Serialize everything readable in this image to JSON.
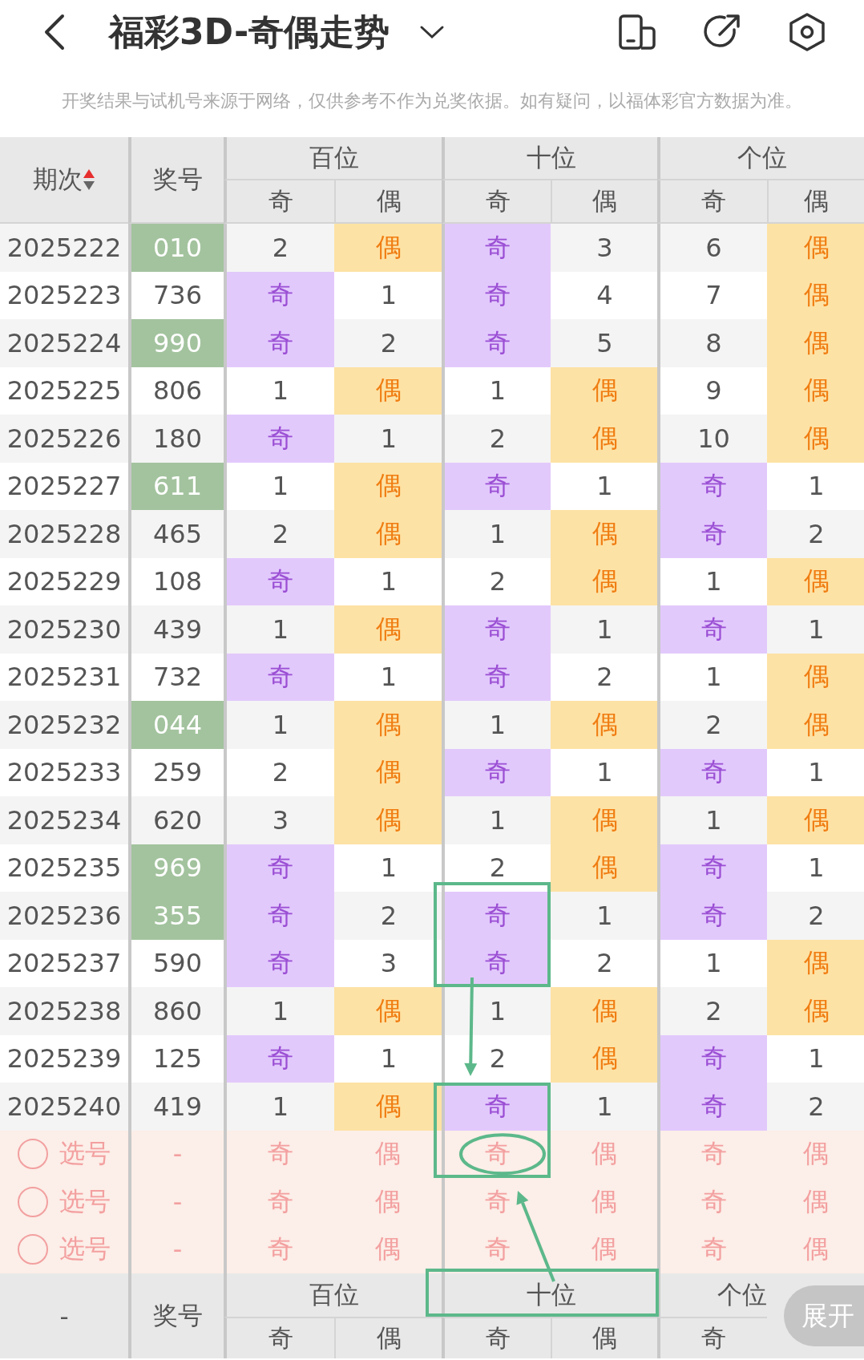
{
  "header": {
    "title": "福彩3D-奇偶走势"
  },
  "notice": "开奖结果与试机号来源于网络，仅供参考不作为兑奖依据。如有疑问，以福体彩官方数据为准。",
  "table": {
    "issue_label": "期次",
    "number_label": "奖号",
    "groups": [
      "百位",
      "十位",
      "个位"
    ],
    "sub_labels": [
      "奇",
      "偶",
      "奇",
      "偶",
      "奇",
      "偶"
    ],
    "rows": [
      {
        "issue": "2025222",
        "number": "010",
        "highlighted": true,
        "cells": [
          {
            "text": "2",
            "hit": false
          },
          {
            "text": "偶",
            "hit": true
          },
          {
            "text": "奇",
            "hit": true
          },
          {
            "text": "3",
            "hit": false
          },
          {
            "text": "6",
            "hit": false
          },
          {
            "text": "偶",
            "hit": true
          }
        ]
      },
      {
        "issue": "2025223",
        "number": "736",
        "highlighted": false,
        "cells": [
          {
            "text": "奇",
            "hit": true
          },
          {
            "text": "1",
            "hit": false
          },
          {
            "text": "奇",
            "hit": true
          },
          {
            "text": "4",
            "hit": false
          },
          {
            "text": "7",
            "hit": false
          },
          {
            "text": "偶",
            "hit": true
          }
        ]
      },
      {
        "issue": "2025224",
        "number": "990",
        "highlighted": true,
        "cells": [
          {
            "text": "奇",
            "hit": true
          },
          {
            "text": "2",
            "hit": false
          },
          {
            "text": "奇",
            "hit": true
          },
          {
            "text": "5",
            "hit": false
          },
          {
            "text": "8",
            "hit": false
          },
          {
            "text": "偶",
            "hit": true
          }
        ]
      },
      {
        "issue": "2025225",
        "number": "806",
        "highlighted": false,
        "cells": [
          {
            "text": "1",
            "hit": false
          },
          {
            "text": "偶",
            "hit": true
          },
          {
            "text": "1",
            "hit": false
          },
          {
            "text": "偶",
            "hit": true
          },
          {
            "text": "9",
            "hit": false
          },
          {
            "text": "偶",
            "hit": true
          }
        ]
      },
      {
        "issue": "2025226",
        "number": "180",
        "highlighted": false,
        "cells": [
          {
            "text": "奇",
            "hit": true
          },
          {
            "text": "1",
            "hit": false
          },
          {
            "text": "2",
            "hit": false
          },
          {
            "text": "偶",
            "hit": true
          },
          {
            "text": "10",
            "hit": false
          },
          {
            "text": "偶",
            "hit": true
          }
        ]
      },
      {
        "issue": "2025227",
        "number": "611",
        "highlighted": true,
        "cells": [
          {
            "text": "1",
            "hit": false
          },
          {
            "text": "偶",
            "hit": true
          },
          {
            "text": "奇",
            "hit": true
          },
          {
            "text": "1",
            "hit": false
          },
          {
            "text": "奇",
            "hit": true
          },
          {
            "text": "1",
            "hit": false
          }
        ]
      },
      {
        "issue": "2025228",
        "number": "465",
        "highlighted": false,
        "cells": [
          {
            "text": "2",
            "hit": false
          },
          {
            "text": "偶",
            "hit": true
          },
          {
            "text": "1",
            "hit": false
          },
          {
            "text": "偶",
            "hit": true
          },
          {
            "text": "奇",
            "hit": true
          },
          {
            "text": "2",
            "hit": false
          }
        ]
      },
      {
        "issue": "2025229",
        "number": "108",
        "highlighted": false,
        "cells": [
          {
            "text": "奇",
            "hit": true
          },
          {
            "text": "1",
            "hit": false
          },
          {
            "text": "2",
            "hit": false
          },
          {
            "text": "偶",
            "hit": true
          },
          {
            "text": "1",
            "hit": false
          },
          {
            "text": "偶",
            "hit": true
          }
        ]
      },
      {
        "issue": "2025230",
        "number": "439",
        "highlighted": false,
        "cells": [
          {
            "text": "1",
            "hit": false
          },
          {
            "text": "偶",
            "hit": true
          },
          {
            "text": "奇",
            "hit": true
          },
          {
            "text": "1",
            "hit": false
          },
          {
            "text": "奇",
            "hit": true
          },
          {
            "text": "1",
            "hit": false
          }
        ]
      },
      {
        "issue": "2025231",
        "number": "732",
        "highlighted": false,
        "cells": [
          {
            "text": "奇",
            "hit": true
          },
          {
            "text": "1",
            "hit": false
          },
          {
            "text": "奇",
            "hit": true
          },
          {
            "text": "2",
            "hit": false
          },
          {
            "text": "1",
            "hit": false
          },
          {
            "text": "偶",
            "hit": true
          }
        ]
      },
      {
        "issue": "2025232",
        "number": "044",
        "highlighted": true,
        "cells": [
          {
            "text": "1",
            "hit": false
          },
          {
            "text": "偶",
            "hit": true
          },
          {
            "text": "1",
            "hit": false
          },
          {
            "text": "偶",
            "hit": true
          },
          {
            "text": "2",
            "hit": false
          },
          {
            "text": "偶",
            "hit": true
          }
        ]
      },
      {
        "issue": "2025233",
        "number": "259",
        "highlighted": false,
        "cells": [
          {
            "text": "2",
            "hit": false
          },
          {
            "text": "偶",
            "hit": true
          },
          {
            "text": "奇",
            "hit": true
          },
          {
            "text": "1",
            "hit": false
          },
          {
            "text": "奇",
            "hit": true
          },
          {
            "text": "1",
            "hit": false
          }
        ]
      },
      {
        "issue": "2025234",
        "number": "620",
        "highlighted": false,
        "cells": [
          {
            "text": "3",
            "hit": false
          },
          {
            "text": "偶",
            "hit": true
          },
          {
            "text": "1",
            "hit": false
          },
          {
            "text": "偶",
            "hit": true
          },
          {
            "text": "1",
            "hit": false
          },
          {
            "text": "偶",
            "hit": true
          }
        ]
      },
      {
        "issue": "2025235",
        "number": "969",
        "highlighted": true,
        "cells": [
          {
            "text": "奇",
            "hit": true
          },
          {
            "text": "1",
            "hit": false
          },
          {
            "text": "2",
            "hit": false
          },
          {
            "text": "偶",
            "hit": true
          },
          {
            "text": "奇",
            "hit": true
          },
          {
            "text": "1",
            "hit": false
          }
        ]
      },
      {
        "issue": "2025236",
        "number": "355",
        "highlighted": true,
        "cells": [
          {
            "text": "奇",
            "hit": true
          },
          {
            "text": "2",
            "hit": false
          },
          {
            "text": "奇",
            "hit": true
          },
          {
            "text": "1",
            "hit": false
          },
          {
            "text": "奇",
            "hit": true
          },
          {
            "text": "2",
            "hit": false
          }
        ]
      },
      {
        "issue": "2025237",
        "number": "590",
        "highlighted": false,
        "cells": [
          {
            "text": "奇",
            "hit": true
          },
          {
            "text": "3",
            "hit": false
          },
          {
            "text": "奇",
            "hit": true
          },
          {
            "text": "2",
            "hit": false
          },
          {
            "text": "1",
            "hit": false
          },
          {
            "text": "偶",
            "hit": true
          }
        ]
      },
      {
        "issue": "2025238",
        "number": "860",
        "highlighted": false,
        "cells": [
          {
            "text": "1",
            "hit": false
          },
          {
            "text": "偶",
            "hit": true
          },
          {
            "text": "1",
            "hit": false
          },
          {
            "text": "偶",
            "hit": true
          },
          {
            "text": "2",
            "hit": false
          },
          {
            "text": "偶",
            "hit": true
          }
        ]
      },
      {
        "issue": "2025239",
        "number": "125",
        "highlighted": false,
        "cells": [
          {
            "text": "奇",
            "hit": true
          },
          {
            "text": "1",
            "hit": false
          },
          {
            "text": "2",
            "hit": false
          },
          {
            "text": "偶",
            "hit": true
          },
          {
            "text": "奇",
            "hit": true
          },
          {
            "text": "1",
            "hit": false
          }
        ]
      },
      {
        "issue": "2025240",
        "number": "419",
        "highlighted": false,
        "cells": [
          {
            "text": "1",
            "hit": false
          },
          {
            "text": "偶",
            "hit": true
          },
          {
            "text": "奇",
            "hit": true
          },
          {
            "text": "1",
            "hit": false
          },
          {
            "text": "奇",
            "hit": true
          },
          {
            "text": "2",
            "hit": false
          }
        ]
      }
    ],
    "pick_rows": [
      {
        "selected": false,
        "label": "选号",
        "number": "-",
        "options": [
          "奇",
          "偶",
          "奇",
          "偶",
          "奇",
          "偶"
        ]
      },
      {
        "selected": false,
        "label": "选号",
        "number": "-",
        "options": [
          "奇",
          "偶",
          "奇",
          "偶",
          "奇",
          "偶"
        ]
      },
      {
        "selected": false,
        "label": "选号",
        "number": "-",
        "options": [
          "奇",
          "偶",
          "奇",
          "偶",
          "奇",
          "偶"
        ]
      }
    ],
    "footer": {
      "issue": "-",
      "number_label": "奖号",
      "groups": [
        "百位",
        "十位",
        "个位"
      ],
      "sub_labels": [
        "奇",
        "偶",
        "奇",
        "偶",
        "奇"
      ]
    }
  },
  "expand_button": "展开",
  "annotations": [
    {
      "kind": "box"
    },
    {
      "kind": "arrow"
    },
    {
      "kind": "box"
    },
    {
      "kind": "ellipse"
    },
    {
      "kind": "box"
    },
    {
      "kind": "arrow"
    }
  ]
}
